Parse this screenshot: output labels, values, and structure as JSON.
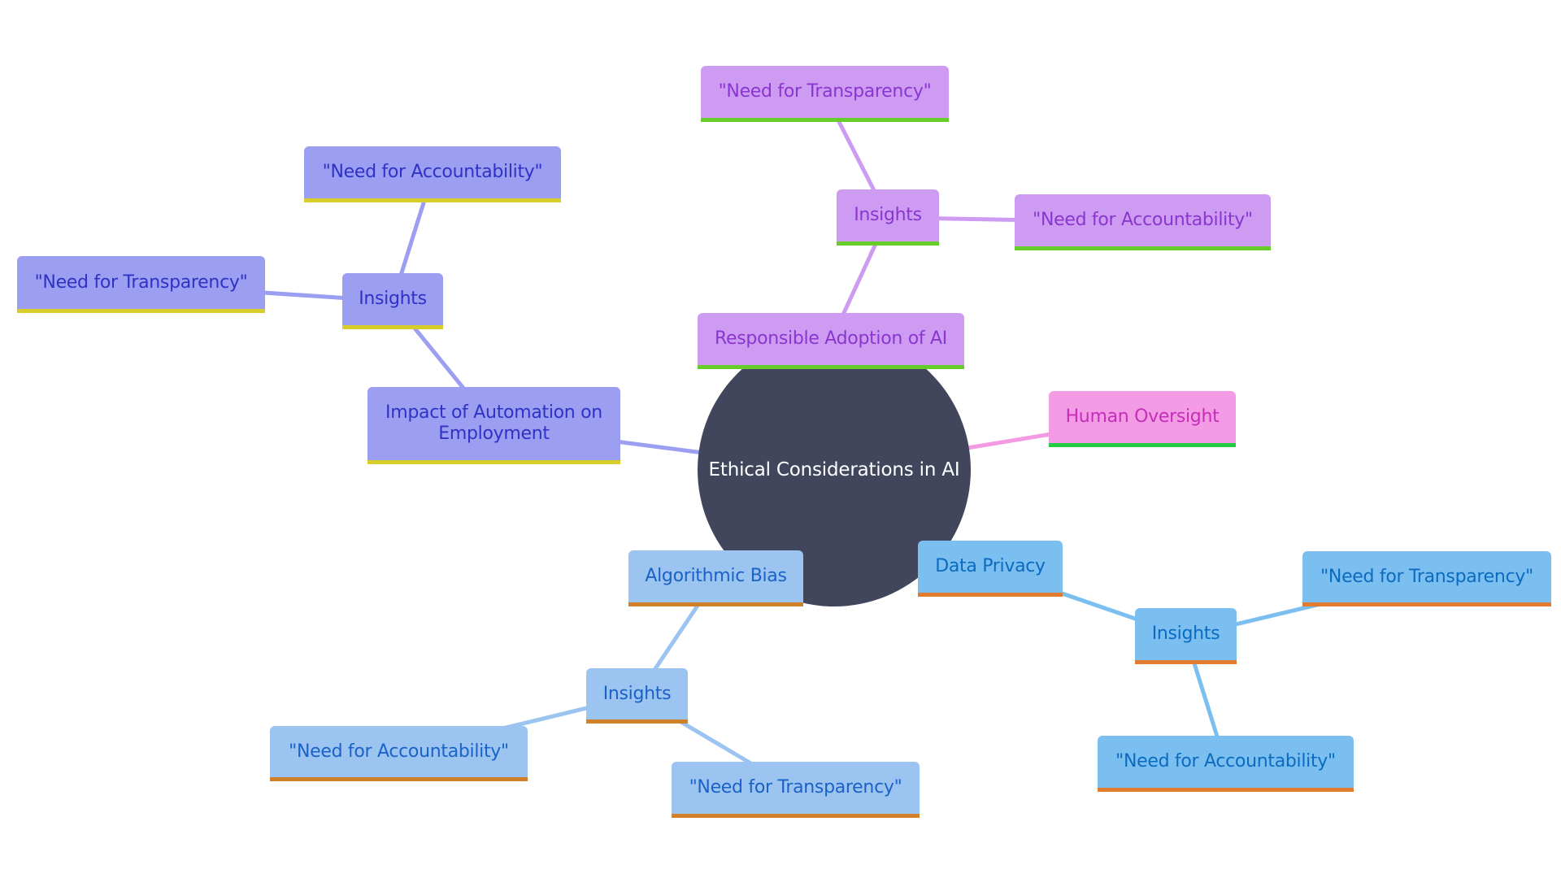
{
  "diagram": {
    "type": "mindmap",
    "root": {
      "id": "root",
      "label": "Ethical Considerations in AI",
      "color": "#41465c",
      "text_color": "#ffffff"
    },
    "themes": {
      "purple": {
        "bg": "#cd9cf2",
        "text": "#8a35d0",
        "border": "#66cc2a",
        "edge": "#cd9cf2"
      },
      "pink": {
        "bg": "#f49be6",
        "text": "#c32fb8",
        "border": "#22cc44",
        "edge": "#f29be4"
      },
      "violet": {
        "bg": "#9b9ef1",
        "text": "#2f33c4",
        "border": "#d6cc2a",
        "edge": "#9b9ef1"
      },
      "lightblue": {
        "bg": "#9cc4f0",
        "text": "#1a62c8",
        "border": "#d08028",
        "edge": "#9cc4f0"
      },
      "skyblue": {
        "bg": "#7bbff1",
        "text": "#0b6bbf",
        "border": "#e07b30",
        "edge": "#7bbff1"
      }
    },
    "nodes": [
      {
        "id": "responsible",
        "label": "Responsible Adoption of AI",
        "parent": "root",
        "theme": "purple"
      },
      {
        "id": "resp-insights",
        "label": "Insights",
        "parent": "responsible",
        "theme": "purple"
      },
      {
        "id": "resp-transparency",
        "label": "\"Need for Transparency\"",
        "parent": "resp-insights",
        "theme": "purple"
      },
      {
        "id": "resp-accountability",
        "label": "\"Need for Accountability\"",
        "parent": "resp-insights",
        "theme": "purple"
      },
      {
        "id": "oversight",
        "label": "Human Oversight",
        "parent": "root",
        "theme": "pink"
      },
      {
        "id": "impact",
        "label": "Impact of Automation on Employment",
        "parent": "root",
        "theme": "violet"
      },
      {
        "id": "impact-insights",
        "label": "Insights",
        "parent": "impact",
        "theme": "violet"
      },
      {
        "id": "impact-accountability",
        "label": "\"Need for Accountability\"",
        "parent": "impact-insights",
        "theme": "violet"
      },
      {
        "id": "impact-transparency",
        "label": "\"Need for Transparency\"",
        "parent": "impact-insights",
        "theme": "violet"
      },
      {
        "id": "bias",
        "label": "Algorithmic Bias",
        "parent": "root",
        "theme": "lightblue"
      },
      {
        "id": "bias-insights",
        "label": "Insights",
        "parent": "bias",
        "theme": "lightblue"
      },
      {
        "id": "bias-accountability",
        "label": "\"Need for Accountability\"",
        "parent": "bias-insights",
        "theme": "lightblue"
      },
      {
        "id": "bias-transparency",
        "label": "\"Need for Transparency\"",
        "parent": "bias-insights",
        "theme": "lightblue"
      },
      {
        "id": "privacy",
        "label": "Data Privacy",
        "parent": "root",
        "theme": "skyblue"
      },
      {
        "id": "privacy-insights",
        "label": "Insights",
        "parent": "privacy",
        "theme": "skyblue"
      },
      {
        "id": "privacy-transparency",
        "label": "\"Need for Transparency\"",
        "parent": "privacy-insights",
        "theme": "skyblue"
      },
      {
        "id": "privacy-accountability",
        "label": "\"Need for Accountability\"",
        "parent": "privacy-insights",
        "theme": "skyblue"
      }
    ]
  }
}
